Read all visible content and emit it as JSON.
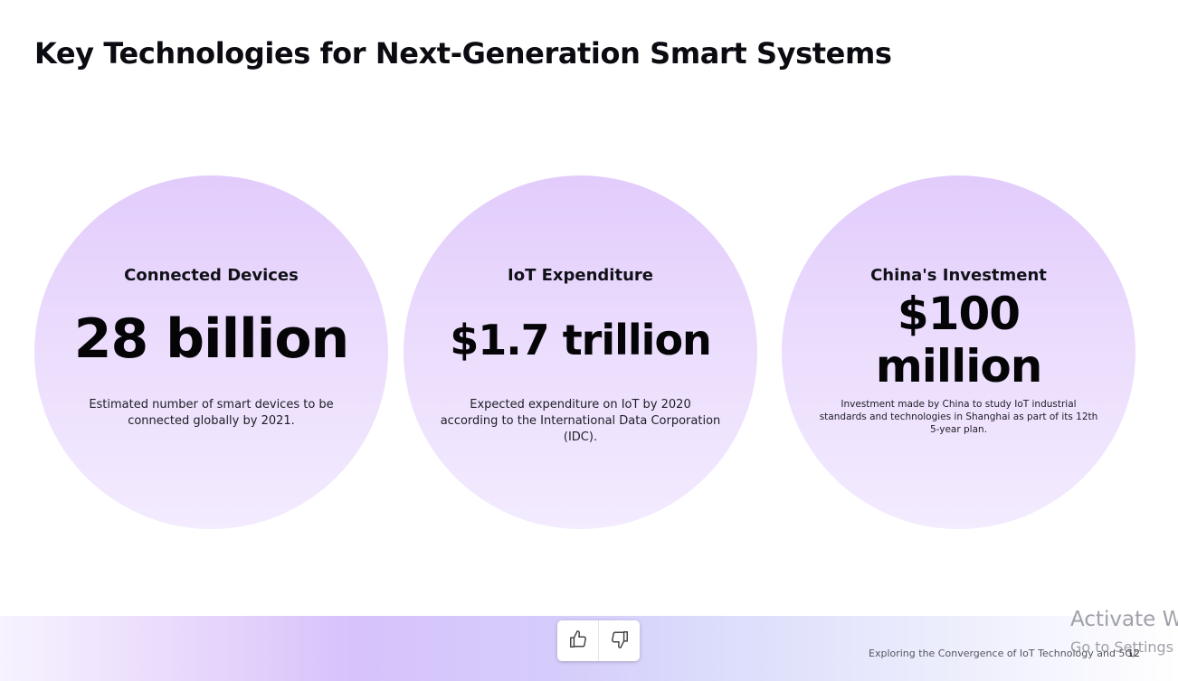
{
  "slide": {
    "title": "Key Technologies for Next-Generation Smart Systems",
    "page_number": "12",
    "footer_text": "Exploring the Convergence of IoT Technology and 5G/"
  },
  "stats": [
    {
      "heading": "Connected Devices",
      "value": "28 billion",
      "description": "Estimated number of smart devices to be connected globally by 2021."
    },
    {
      "heading": "IoT Expenditure",
      "value": "$1.7 trillion",
      "description": "Expected expenditure on IoT by 2020 according to the International Data Corporation (IDC)."
    },
    {
      "heading": "China's Investment",
      "value": "$100 million",
      "description": "Investment made by China to study IoT industrial standards and technologies in Shanghai as part of its 12th 5-year plan."
    }
  ],
  "feedback": {
    "like_icon": "thumbs-up-icon",
    "dislike_icon": "thumbs-down-icon"
  },
  "watermark": {
    "line1": "Activate W",
    "line2": "Go to Settings"
  },
  "colors": {
    "circle_top": "#e2ccfc",
    "circle_bottom": "#f3ebfe",
    "text": "#0b0b12"
  }
}
